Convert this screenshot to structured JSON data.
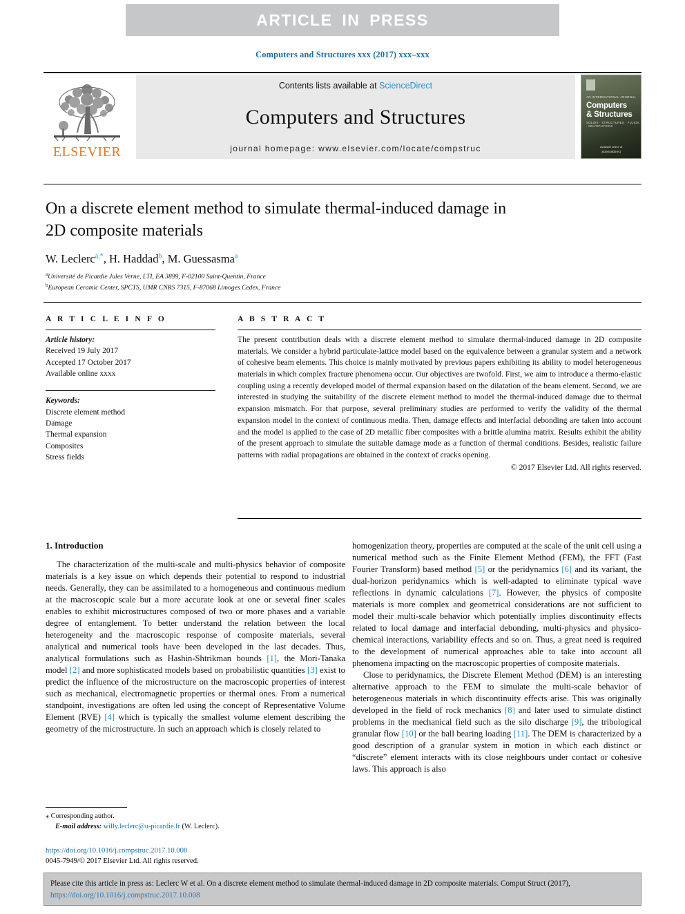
{
  "banner": {
    "text": "ARTICLE IN PRESS"
  },
  "journal_ref": "Computers and Structures xxx (2017) xxx–xxx",
  "masthead": {
    "contents_prefix": "Contents lists available at ",
    "sciencedirect": "ScienceDirect",
    "journal_title": "Computers and Structures",
    "homepage": "journal homepage: www.elsevier.com/locate/compstruc",
    "publisher": "ELSEVIER",
    "cover": {
      "small_top": "AN INTERNATIONAL JOURNAL",
      "line1": "Computers",
      "line2": "& Structures",
      "subtitle": "SOLIDS · STRUCTURES · FLUIDS · MULTIPHYSICS",
      "foot1": "Available online at",
      "foot2": "ScienceDirect"
    }
  },
  "article": {
    "title": "On a discrete element method to simulate thermal-induced damage in 2D composite materials",
    "authors_html": "W. Leclerc, H. Haddad, M. Guessasma",
    "author_list": [
      {
        "name": "W. Leclerc",
        "marks": "a,*"
      },
      {
        "name": "H. Haddad",
        "marks": "b"
      },
      {
        "name": "M. Guessasma",
        "marks": "a"
      }
    ],
    "affiliations": [
      {
        "mark": "a",
        "text": "Université de Picardie Jules Verne, LTI, EA 3899, F-02100 Saint-Quentin, France"
      },
      {
        "mark": "b",
        "text": "European Ceramic Center, SPCTS, UMR CNRS 7315, F-87068 Limoges Cedex, France"
      }
    ]
  },
  "info": {
    "heading": "A R T I C L E  I N F O",
    "history_label": "Article history:",
    "history": [
      "Received 19 July 2017",
      "Accepted 17 October 2017",
      "Available online xxxx"
    ],
    "keywords_label": "Keywords:",
    "keywords": [
      "Discrete element method",
      "Damage",
      "Thermal expansion",
      "Composites",
      "Stress fields"
    ]
  },
  "abstract": {
    "heading": "A B S T R A C T",
    "text": "The present contribution deals with a discrete element method to simulate thermal-induced damage in 2D composite materials. We consider a hybrid particulate-lattice model based on the equivalence between a granular system and a network of cohesive beam elements. This choice is mainly motivated by previous papers exhibiting its ability to model heterogeneous materials in which complex fracture phenomena occur. Our objectives are twofold. First, we aim to introduce a thermo-elastic coupling using a recently developed model of thermal expansion based on the dilatation of the beam element. Second, we are interested in studying the suitability of the discrete element method to model the thermal-induced damage due to thermal expansion mismatch. For that purpose, several preliminary studies are performed to verify the validity of the thermal expansion model in the context of continuous media. Then, damage effects and interfacial debonding are taken into account and the model is applied to the case of 2D metallic fiber composites with a brittle alumina matrix. Results exhibit the ability of the present approach to simulate the suitable damage mode as a function of thermal conditions. Besides, realistic failure patterns with radial propagations are obtained in the context of cracks opening.",
    "copyright": "© 2017 Elsevier Ltd. All rights reserved."
  },
  "body": {
    "section_title": "1. Introduction",
    "left_paragraphs": [
      "The characterization of the multi-scale and multi-physics behavior of composite materials is a key issue on which depends their potential to respond to industrial needs. Generally, they can be assimilated to a homogeneous and continuous medium at the macroscopic scale but a more accurate look at one or several finer scales enables to exhibit microstructures composed of two or more phases and a variable degree of entanglement. To better understand the relation between the local heterogeneity and the macroscopic response of composite materials, several analytical and numerical tools have been developed in the last decades. Thus, analytical formulations such as Hashin-Shtrikman bounds [1], the Mori-Tanaka model [2] and more sophisticated models based on probabilistic quantities [3] exist to predict the influence of the microstructure on the macroscopic properties of interest such as mechanical, electromagnetic properties or thermal ones. From a numerical standpoint, investigations are often led using the concept of Representative Volume Element (RVE) [4] which is typically the smallest volume element describing the geometry of the microstructure. In such an approach which is closely related to"
    ],
    "right_paragraphs": [
      "homogenization theory, properties are computed at the scale of the unit cell using a numerical method such as the Finite Element Method (FEM), the FFT (Fast Fourier Transform) based method [5] or the peridynamics [6] and its variant, the dual-horizon peridynamics which is well-adapted to eliminate typical wave reflections in dynamic calculations [7]. However, the physics of composite materials is more complex and geometrical considerations are not sufficient to model their multi-scale behavior which potentially implies discontinuity effects related to local damage and interfacial debonding, multi-physics and physico-chemical interactions, variability effects and so on. Thus, a great need is required to the development of numerical approaches able to take into account all phenomena impacting on the macroscopic properties of composite materials.",
      "Close to peridynamics, the Discrete Element Method (DEM) is an interesting alternative approach to the FEM to simulate the multi-scale behavior of heterogeneous materials in which discontinuity effects arise. This was originally developed in the field of rock mechanics [8] and later used to simulate distinct problems in the mechanical field such as the silo discharge [9], the tribological granular flow [10] or the ball bearing loading [11]. The DEM is characterized by a good description of a granular system in motion in which each distinct or “discrete” element interacts with its close neighbours under contact or cohesive laws. This approach is also"
    ]
  },
  "footnote": {
    "star": "⁎",
    "corresponding": "Corresponding author.",
    "email_label": "E-mail address:",
    "email": "willy.leclerc@u-picardie.fr",
    "email_owner": "(W. Leclerc)."
  },
  "doi_block": {
    "doi_url": "https://doi.org/10.1016/j.compstruc.2017.10.008",
    "issn_line": "0045-7949/© 2017 Elsevier Ltd. All rights reserved."
  },
  "citation_box": {
    "prefix": "Please cite this article in press as: Leclerc W et al. On a discrete element method to simulate thermal-induced damage in 2D composite materials. Comput Struct (2017), ",
    "doi": "https://doi.org/10.1016/j.compstruc.2017.10.008"
  },
  "colors": {
    "banner_bg": "#c6c7c9",
    "link_blue": "#1670a8",
    "ref_blue": "#1a8fc1",
    "elsevier_orange": "#e87722",
    "sciencedirect_blue": "#2196d6"
  }
}
